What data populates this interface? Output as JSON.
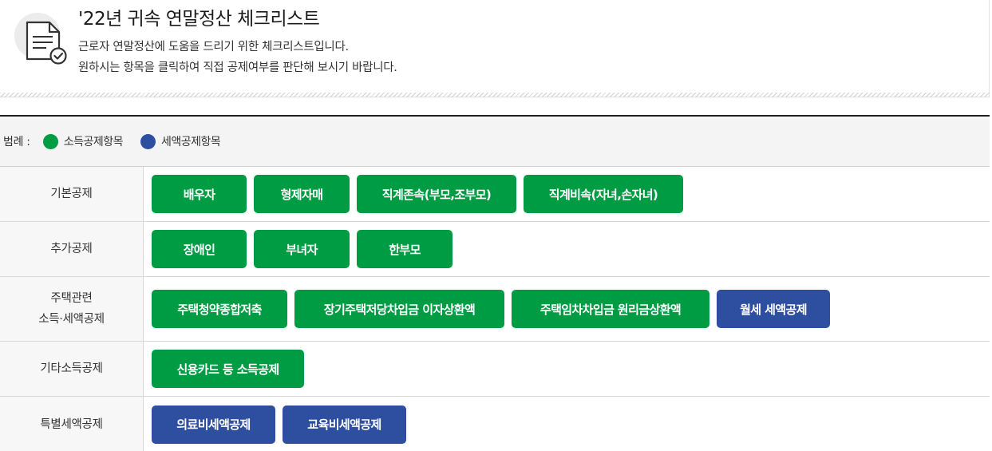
{
  "header": {
    "title": "'22년 귀속 연말정산 체크리스트",
    "desc1": "근로자 연말정산에 도움을 드리기 위한 체크리스트입니다.",
    "desc2": "원하시는 항목을 클릭하여 직접 공제여부를 판단해 보시기 바랍니다.",
    "icon": "document-check-icon"
  },
  "legend": {
    "label": "범례 :",
    "income": "소득공제항목",
    "tax": "세액공제항목"
  },
  "colors": {
    "income": "#009c44",
    "tax": "#2e4f9f"
  },
  "rows": [
    {
      "category": "기본공제",
      "buttons": [
        "배우자",
        "형제자매",
        "직계존속(부모,조부모)",
        "직계비속(자녀,손자녀)"
      ]
    },
    {
      "category": "추가공제",
      "buttons": [
        "장애인",
        "부녀자",
        "한부모"
      ]
    },
    {
      "category_line1": "주택관련",
      "category_line2": "소득·세액공제",
      "buttons": [
        "주택청약종합저축",
        "장기주택저당차입금 이자상환액",
        "주택임차차입금 원리금상환액",
        "월세 세액공제"
      ]
    },
    {
      "category": "기타소득공제",
      "buttons": [
        "신용카드 등 소득공제"
      ]
    },
    {
      "category": "특별세액공제",
      "buttons": [
        "의료비세액공제",
        "교육비세액공제"
      ]
    }
  ]
}
